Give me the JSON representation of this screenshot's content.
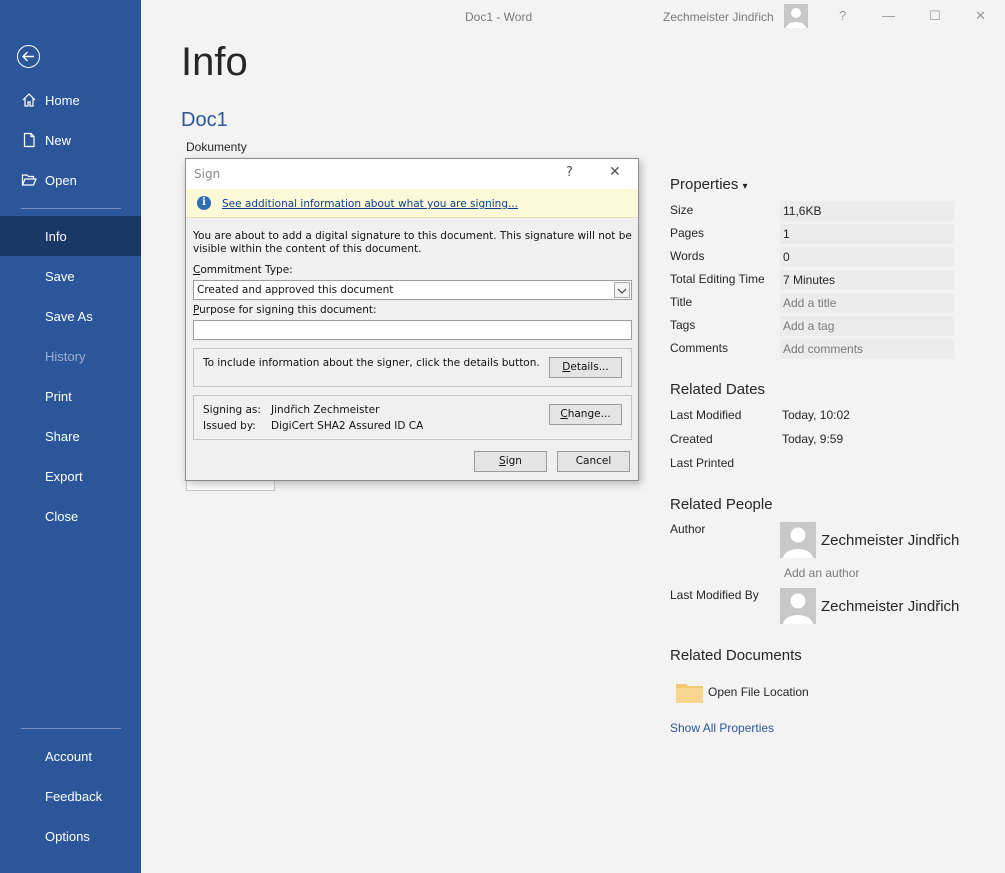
{
  "titlebar": {
    "title": "Doc1  -  Word",
    "user": "Zechmeister Jindřich",
    "help": "?",
    "minimize": "—",
    "maximize": "☐",
    "close": "✕"
  },
  "sidebar": {
    "top_items": [
      {
        "label": "Home",
        "icon": "home-icon"
      },
      {
        "label": "New",
        "icon": "new-document-icon"
      },
      {
        "label": "Open",
        "icon": "open-folder-icon"
      }
    ],
    "items": [
      {
        "label": "Info",
        "active": true
      },
      {
        "label": "Save"
      },
      {
        "label": "Save As"
      },
      {
        "label": "History",
        "disabled": true
      },
      {
        "label": "Print"
      },
      {
        "label": "Share"
      },
      {
        "label": "Export"
      },
      {
        "label": "Close"
      }
    ],
    "bottom_items": [
      {
        "label": "Account"
      },
      {
        "label": "Feedback"
      },
      {
        "label": "Options"
      }
    ]
  },
  "main": {
    "heading": "Info",
    "doc_name": "Doc1",
    "doc_location": "Dokumenty"
  },
  "properties": {
    "title": "Properties",
    "dropdown": "▾",
    "rows": [
      {
        "key": "Size",
        "value": "11,6KB"
      },
      {
        "key": "Pages",
        "value": "1"
      },
      {
        "key": "Words",
        "value": "0"
      },
      {
        "key": "Total Editing Time",
        "value": "7 Minutes"
      },
      {
        "key": "Title",
        "value": "Add a title",
        "placeholder": true
      },
      {
        "key": "Tags",
        "value": "Add a tag",
        "placeholder": true
      },
      {
        "key": "Comments",
        "value": "Add comments",
        "placeholder": true
      }
    ]
  },
  "related_dates": {
    "title": "Related Dates",
    "rows": [
      {
        "key": "Last Modified",
        "value": "Today, 10:02"
      },
      {
        "key": "Created",
        "value": "Today, 9:59"
      },
      {
        "key": "Last Printed",
        "value": ""
      }
    ]
  },
  "related_people": {
    "title": "Related People",
    "author_key": "Author",
    "author_name": "Zechmeister Jindřich",
    "add_author": "Add an author",
    "modified_key": "Last Modified By",
    "modified_name": "Zechmeister Jindřich"
  },
  "related_documents": {
    "title": "Related Documents",
    "open_location": "Open File Location",
    "show_all": "Show All Properties"
  },
  "dialog": {
    "title": "Sign",
    "help": "?",
    "close": "✕",
    "info_link": "See additional information about what you are signing...",
    "description_line1": "You are about to add a digital signature to this document. This signature will not be",
    "description_line2": "visible within the content of this document.",
    "commitment_label": "ommitment Type:",
    "commitment_label_accel": "C",
    "commitment_value": "Created and approved this document",
    "purpose_label": "urpose for signing this document:",
    "purpose_label_accel": "P",
    "purpose_value": "",
    "details_text": "To include information about the signer, click the details button.",
    "details_button_accel": "D",
    "details_button": "etails...",
    "signing_as_key": "Signing as:",
    "signing_as_value": "Jindřich Zechmeister",
    "issued_by_key": "Issued by:",
    "issued_by_value": "DigiCert SHA2 Assured ID CA",
    "change_button_accel": "C",
    "change_button": "hange...",
    "sign_button_accel": "S",
    "sign_button": "ign",
    "cancel_button": "Cancel"
  },
  "colors": {
    "sidebar": "#2b579a",
    "sidebar_active": "#1a3866",
    "accent": "#2b579a"
  }
}
